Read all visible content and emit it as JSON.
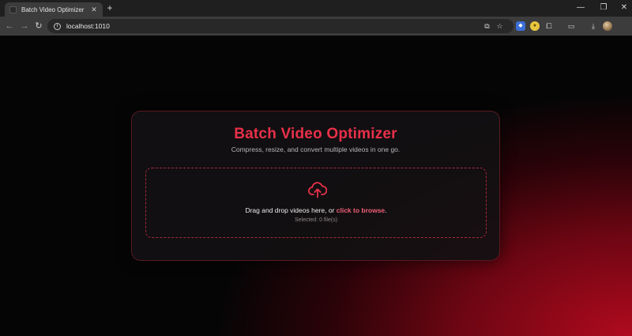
{
  "browser": {
    "tab_title": "Batch Video Optimizer",
    "address": "localhost:1010"
  },
  "icons": {
    "tab": [
      "favicon-icon",
      "close-icon",
      "new-tab-icon"
    ],
    "window": [
      "minimize-icon",
      "restore-icon",
      "close-window-icon"
    ],
    "nav": [
      "back-arrow-icon",
      "forward-arrow-icon",
      "reload-icon"
    ],
    "omnibox": [
      "site-info-icon",
      "install-app-icon",
      "bookmark-star-icon"
    ],
    "toolbar": [
      "shield-extension-icon",
      "coin-extension-icon",
      "extensions-puzzle-icon",
      "side-panel-icon",
      "download-icon",
      "profile-avatar"
    ],
    "page": [
      "cloud-upload-icon"
    ]
  },
  "colors": {
    "accent": "#e8304a",
    "link": "#ee5f75",
    "dropzone_border": "#a8283c"
  },
  "app": {
    "title": "Batch Video Optimizer",
    "subtitle": "Compress, resize, and convert multiple videos in one go.",
    "dropzone": {
      "prompt": "Drag and drop videos here, or ",
      "browse_link": "click to browse",
      "prompt_end": ".",
      "selected": "Selected: 0 file(s)"
    }
  }
}
